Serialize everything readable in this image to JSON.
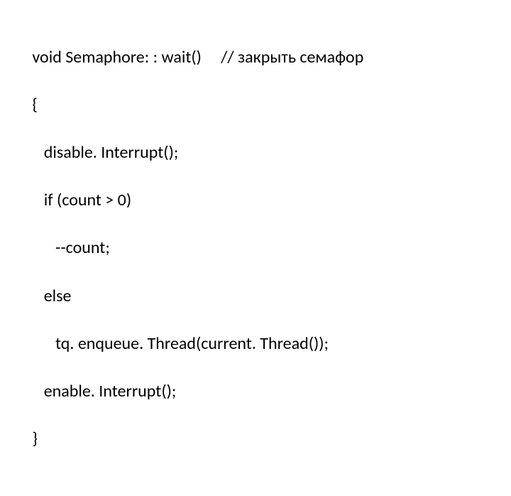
{
  "code": {
    "l1_a": " void Semaphore: : wait()     ",
    "l1_b": "// закрыть семафор",
    "l2": " {",
    "l3": "    disable. Interrupt();",
    "l4": "    if (count > 0)",
    "l5": "       --count;",
    "l6": "    else",
    "l7": "       tq. enqueue. Thread(current. Thread());",
    "l8": "    enable. Interrupt();",
    "l9": " }"
  }
}
